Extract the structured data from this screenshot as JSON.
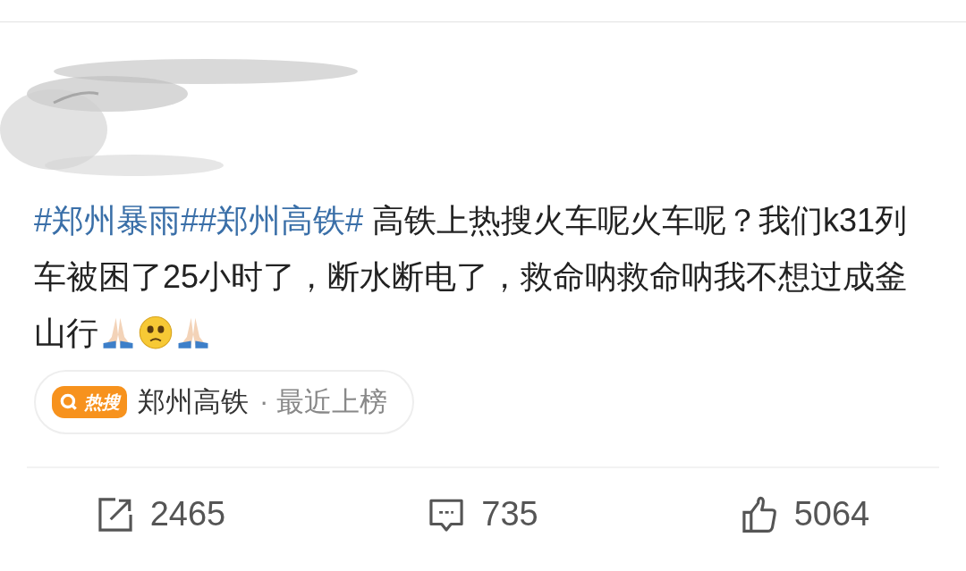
{
  "post": {
    "segments": [
      {
        "kind": "hashtag",
        "text": "#郑州暴雨#"
      },
      {
        "kind": "hashtag",
        "text": "#郑州高铁#"
      },
      {
        "kind": "text",
        "text": " 高铁上热搜火车呢火车呢？我们k31列车被困了25小时了，断水断电了，救命呐救命呐我不想过成釜山行"
      }
    ]
  },
  "hot_search": {
    "badge": "热搜",
    "topic": "郑州高铁",
    "note": "· 最近上榜"
  },
  "actions": [
    {
      "kind": "repost",
      "count": "2465"
    },
    {
      "kind": "comment",
      "count": "735"
    },
    {
      "kind": "like",
      "count": "5064"
    }
  ]
}
